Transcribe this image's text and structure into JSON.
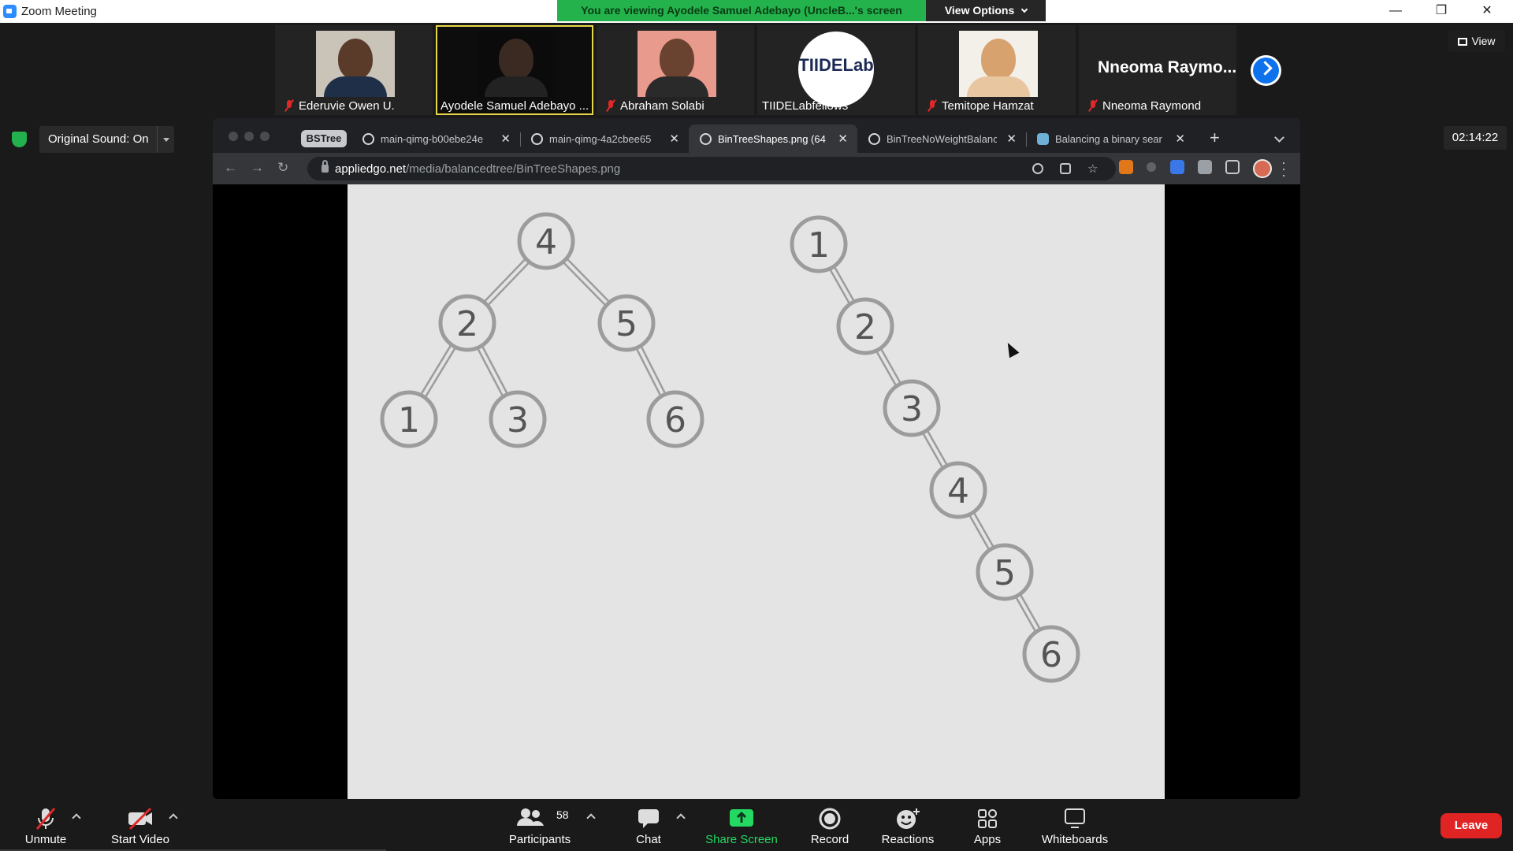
{
  "window": {
    "title": "Zoom Meeting",
    "banner": "You are viewing Ayodele Samuel Adebayo (UncleB...'s screen",
    "view_options": "View Options",
    "minimize": "—",
    "restore": "❐",
    "close": "✕"
  },
  "participants": [
    {
      "name": "Ederuvie Owen U.",
      "muted": true,
      "skin": "#5a3b2a",
      "shirt": "#1f2f48",
      "bg": "#c9c3b8"
    },
    {
      "name": "Ayodele Samuel Adebayo ...",
      "muted": false,
      "skin": "#3a2a22",
      "shirt": "#111",
      "bg": "#0b0b0b"
    },
    {
      "name": "Abraham Solabi",
      "muted": true,
      "skin": "#6a4230",
      "shirt": "#2a2a2a",
      "bg": "#e89a8c"
    },
    {
      "name": "TIIDELabfellows",
      "muted": false,
      "logo": "TIIDELab"
    },
    {
      "name": "Temitope Hamzat",
      "muted": true,
      "skin": "#d7a26d",
      "shirt": "#e8c6a0",
      "bg": "#f3efe9"
    },
    {
      "name": "Nneoma Raymond",
      "muted": true,
      "big_name": "Nneoma  Raymo..."
    }
  ],
  "view_button": "View",
  "sound": {
    "label": "Original Sound: On"
  },
  "timer": "02:14:22",
  "browser": {
    "group_chip": "BSTree",
    "tabs": [
      {
        "label": "main-qimg-b00ebe24e",
        "active": false
      },
      {
        "label": "main-qimg-4a2cbee65",
        "active": false
      },
      {
        "label": "BinTreeShapes.png (64",
        "active": true
      },
      {
        "label": "BinTreeNoWeightBalanc",
        "active": false
      },
      {
        "label": "Balancing a binary sear",
        "active": false
      }
    ],
    "new_tab": "+",
    "url_host": "appliedgo.net",
    "url_path": "/media/balancedtree/BinTreeShapes.png",
    "back": "←",
    "forward": "→",
    "reload": "↻"
  },
  "trees": {
    "balanced": {
      "nodes": [
        "4",
        "2",
        "5",
        "1",
        "3",
        "6"
      ]
    },
    "degenerate": {
      "nodes": [
        "1",
        "2",
        "3",
        "4",
        "5",
        "6"
      ]
    }
  },
  "controls": {
    "unmute": "Unmute",
    "start_video": "Start Video",
    "participants": "Participants",
    "participant_count": "58",
    "chat": "Chat",
    "share_screen": "Share Screen",
    "record": "Record",
    "reactions": "Reactions",
    "apps": "Apps",
    "whiteboards": "Whiteboards",
    "leave": "Leave"
  }
}
